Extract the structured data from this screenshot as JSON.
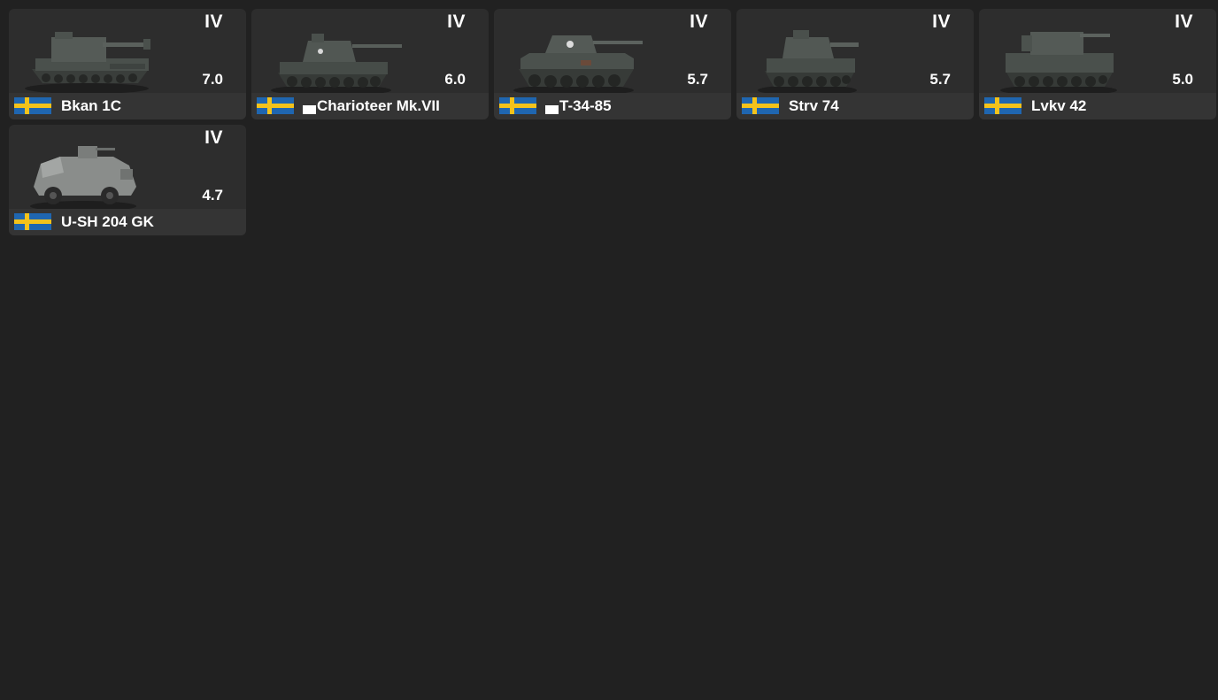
{
  "colors": {
    "background": "#212121",
    "card": "#2d2d2d",
    "card_footer": "#343434",
    "text": "#ffffff",
    "flag_blue": "#1f66b0",
    "flag_yellow": "#f3c21b"
  },
  "vehicles": [
    {
      "rank": "IV",
      "br": "7.0",
      "name": "Bkan 1C",
      "flag_icon": "sweden-flag-icon",
      "premium_marker": false,
      "image_icon": "spg-vehicle-icon"
    },
    {
      "rank": "IV",
      "br": "6.0",
      "name": "Charioteer Mk.VII",
      "flag_icon": "sweden-flag-icon",
      "premium_marker": true,
      "image_icon": "tank-vehicle-icon"
    },
    {
      "rank": "IV",
      "br": "5.7",
      "name": "T-34-85",
      "flag_icon": "sweden-flag-icon",
      "premium_marker": true,
      "image_icon": "tank-vehicle-icon"
    },
    {
      "rank": "IV",
      "br": "5.7",
      "name": "Strv 74",
      "flag_icon": "sweden-flag-icon",
      "premium_marker": false,
      "image_icon": "tank-vehicle-icon"
    },
    {
      "rank": "IV",
      "br": "5.0",
      "name": "Lvkv 42",
      "flag_icon": "sweden-flag-icon",
      "premium_marker": false,
      "image_icon": "spaa-vehicle-icon"
    },
    {
      "rank": "IV",
      "br": "4.7",
      "name": "U-SH 204 GK",
      "flag_icon": "sweden-flag-icon",
      "premium_marker": false,
      "image_icon": "armored-car-vehicle-icon"
    }
  ]
}
